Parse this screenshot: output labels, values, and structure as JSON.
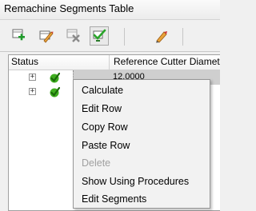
{
  "window": {
    "title": "Remachine Segments Table"
  },
  "toolbar": {
    "buttons": [
      {
        "icon": "add-row-icon"
      },
      {
        "icon": "edit-row-icon"
      },
      {
        "icon": "delete-row-icon"
      },
      {
        "icon": "calculate-icon"
      },
      {
        "icon": "edit-segments-icon"
      }
    ]
  },
  "table": {
    "columns": [
      "Status",
      "Reference Cutter Diameter"
    ],
    "rows": [
      {
        "expander": "+",
        "status": "ok",
        "reference_cutter_diameter": "12.0000",
        "selected": true
      },
      {
        "expander": "+",
        "status": "ok",
        "reference_cutter_diameter": "",
        "selected": false
      }
    ]
  },
  "context_menu": {
    "items": [
      {
        "label": "Calculate",
        "enabled": true
      },
      {
        "label": "Edit Row",
        "enabled": true
      },
      {
        "label": "Copy Row",
        "enabled": true
      },
      {
        "label": "Paste Row",
        "enabled": true
      },
      {
        "label": "Delete",
        "enabled": false
      },
      {
        "label": "Show Using Procedures",
        "enabled": true
      },
      {
        "label": "Edit Segments",
        "enabled": true
      }
    ]
  },
  "colors": {
    "status_ok": "#3fae1f",
    "selection": "#cfcfcf",
    "disabled_text": "#a0a0a0"
  }
}
